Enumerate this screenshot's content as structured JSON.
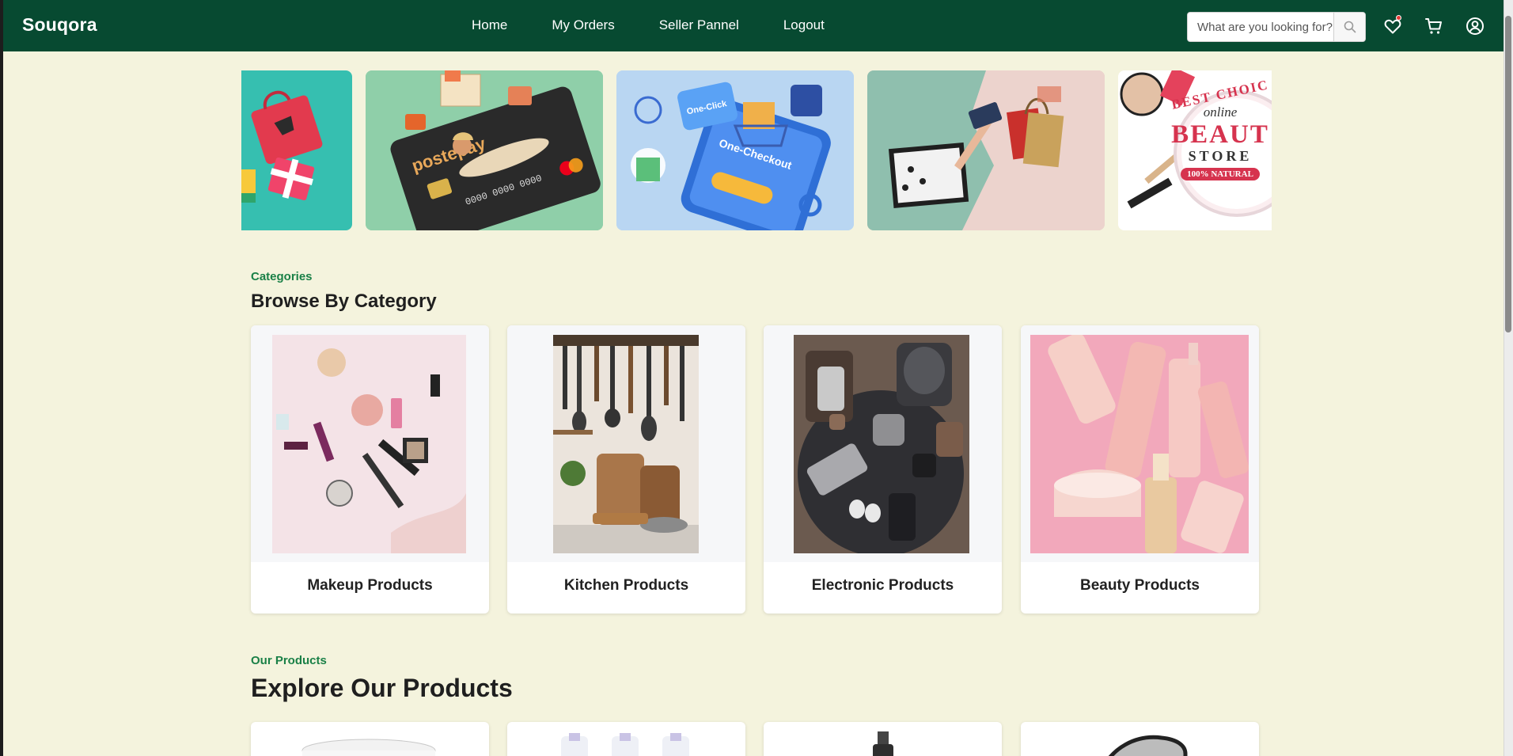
{
  "app": {
    "brand": "Souqora"
  },
  "nav": {
    "links": [
      "Home",
      "My Orders",
      "Seller Pannel",
      "Logout"
    ],
    "search_placeholder": "What are you looking for?",
    "icons": [
      "heart-icon",
      "cart-icon",
      "user-icon"
    ]
  },
  "banners": [
    {
      "name": "gift-shopping-banner"
    },
    {
      "name": "postepay-card-banner"
    },
    {
      "name": "one-click-checkout-banner"
    },
    {
      "name": "online-card-payment-banner"
    },
    {
      "name": "beauty-store-banner",
      "text": [
        "BEST CHOIC",
        "online",
        "BEAUT",
        "STORE",
        "100% NATURAL"
      ]
    }
  ],
  "categories": {
    "eyebrow": "Categories",
    "title": "Browse By Category",
    "items": [
      {
        "label": "Makeup Products"
      },
      {
        "label": "Kitchen Products"
      },
      {
        "label": "Electronic Products"
      },
      {
        "label": "Beauty Products"
      }
    ]
  },
  "products": {
    "eyebrow": "Our Products",
    "title": "Explore Our Products"
  },
  "colors": {
    "navbar": "#074a31",
    "page_bg": "#f4f3dd",
    "accent_green": "#1a8047",
    "badge": "#e53935"
  }
}
